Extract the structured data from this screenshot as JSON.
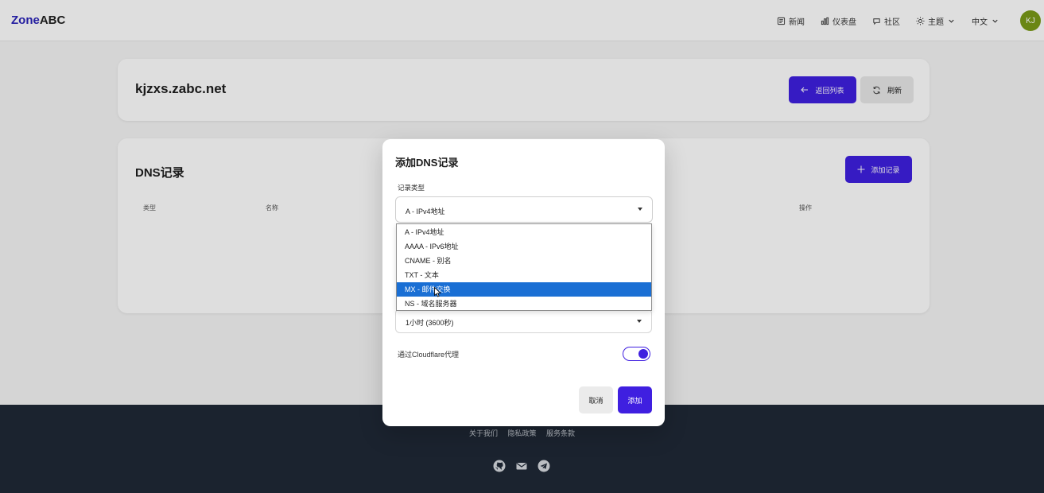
{
  "header": {
    "brand_part1": "Zone",
    "brand_part2": "ABC",
    "nav": [
      {
        "label": "新闻",
        "icon": "newspaper-icon"
      },
      {
        "label": "仪表盘",
        "icon": "chart-icon"
      },
      {
        "label": "社区",
        "icon": "chat-icon"
      },
      {
        "label": "主题",
        "icon": "sun-icon"
      }
    ],
    "language": "中文",
    "avatar_initials": "KJ"
  },
  "domain_card": {
    "domain": "kjzxs.zabc.net",
    "back_button": "返回列表",
    "refresh_button": "刷新"
  },
  "dns_card": {
    "title": "DNS记录",
    "add_button": "添加记录",
    "columns": [
      "类型",
      "名称",
      "操作"
    ]
  },
  "modal": {
    "title": "添加DNS记录",
    "record_type_label": "记录类型",
    "record_type_value": "A - IPv4地址",
    "record_type_options": [
      "A - IPv4地址",
      "AAAA - IPv6地址",
      "CNAME - 别名",
      "TXT - 文本",
      "MX - 邮件交换",
      "NS - 域名服务器"
    ],
    "highlighted_option_index": 4,
    "ttl_value": "1小时 (3600秒)",
    "proxy_label": "通过Cloudflare代理",
    "proxy_enabled": true,
    "cancel_button": "取消",
    "submit_button": "添加"
  },
  "footer": {
    "links": [
      "关于我们",
      "隐私政策",
      "服务条款"
    ],
    "icons": [
      "github-icon",
      "mail-icon",
      "telegram-icon"
    ]
  },
  "colors": {
    "primary": "#3f1fe0",
    "highlight": "#1a6fd4",
    "footer_bg": "#1f2937"
  }
}
